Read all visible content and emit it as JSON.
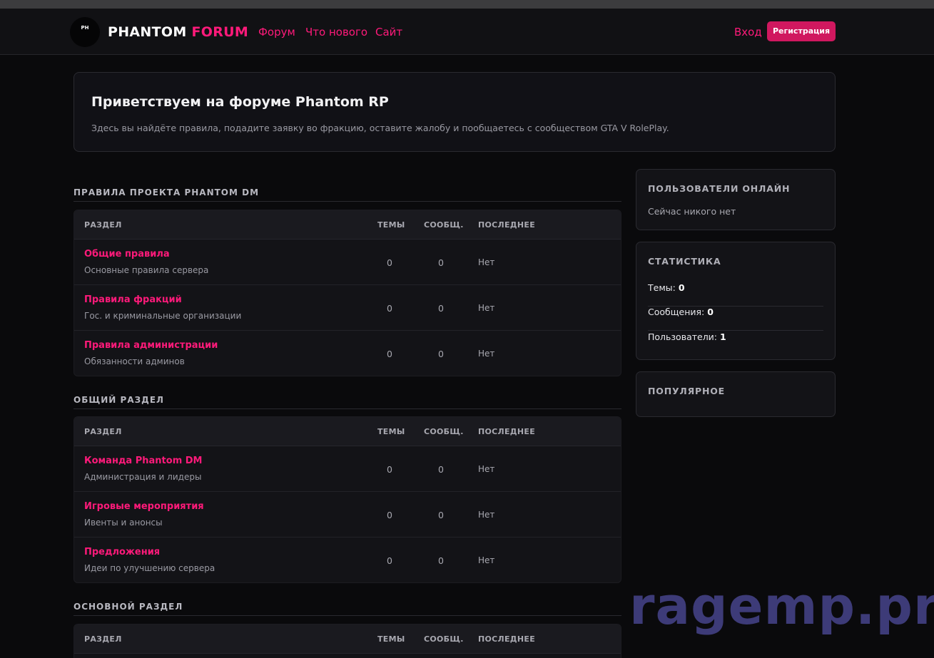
{
  "header": {
    "logo_text": "PH",
    "brand_white": "PHANTOM",
    "brand_pink": "FORUM",
    "nav": [
      "Форум",
      "Что нового",
      "Сайт"
    ],
    "login": "Вход",
    "register": "Регистрация"
  },
  "welcome": {
    "title": "Приветствуем на форуме Phantom RP",
    "text": "Здесь вы найдёте правила, подадите заявку во фракцию, оставите жалобу и пообщаетесь с сообществом GTA V RolePlay."
  },
  "columns": [
    "РАЗДЕЛ",
    "ТЕМЫ",
    "СООБЩ.",
    "ПОСЛЕДНЕЕ"
  ],
  "sections": [
    {
      "title": "ПРАВИЛА ПРОЕКТА PHANTOM DM",
      "rows": [
        {
          "name": "Общие правила",
          "desc": "Основные правила сервера",
          "topics": "0",
          "posts": "0",
          "last": "Нет"
        },
        {
          "name": "Правила фракций",
          "desc": "Гос. и криминальные организации",
          "topics": "0",
          "posts": "0",
          "last": "Нет"
        },
        {
          "name": "Правила администрации",
          "desc": "Обязанности админов",
          "topics": "0",
          "posts": "0",
          "last": "Нет"
        }
      ]
    },
    {
      "title": "ОБЩИЙ РАЗДЕЛ",
      "rows": [
        {
          "name": "Команда Phantom DM",
          "desc": "Администрация и лидеры",
          "topics": "0",
          "posts": "0",
          "last": "Нет"
        },
        {
          "name": "Игровые мероприятия",
          "desc": "Ивенты и анонсы",
          "topics": "0",
          "posts": "0",
          "last": "Нет"
        },
        {
          "name": "Предложения",
          "desc": "Идеи по улучшению сервера",
          "topics": "0",
          "posts": "0",
          "last": "Нет"
        }
      ]
    },
    {
      "title": "ОСНОВНОЙ РАЗДЕЛ",
      "rows": []
    }
  ],
  "sidebar": {
    "online": {
      "title": "ПОЛЬЗОВАТЕЛИ ОНЛАЙН",
      "text": "Сейчас никого нет"
    },
    "stats": {
      "title": "СТАТИСТИКА",
      "items": [
        {
          "label": "Темы:",
          "value": "0"
        },
        {
          "label": "Сообщения:",
          "value": "0"
        },
        {
          "label": "Пользователи:",
          "value": "1"
        }
      ]
    },
    "popular": {
      "title": "ПОПУЛЯРНОЕ"
    }
  },
  "watermark": "ragemp.pro",
  "colors": {
    "accent": "#ff1a7a",
    "button": "#d0185f",
    "background": "#0a0a0c"
  }
}
